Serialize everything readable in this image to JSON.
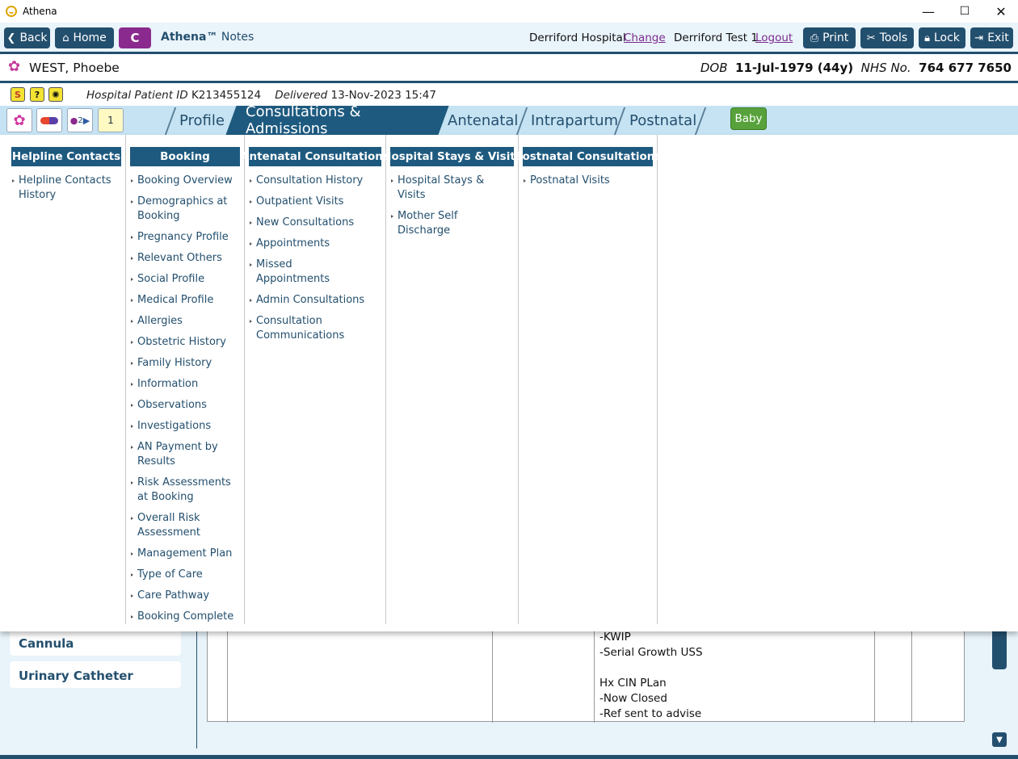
{
  "window": {
    "title": "Athena",
    "minimize": "—",
    "maximize": "☐",
    "close": "✕"
  },
  "toolbar": {
    "back": "Back",
    "home": "Home",
    "c_label": "C",
    "app_brand": "Athena™",
    "app_section": "Notes",
    "hospital": "Derriford Hospital",
    "change": "Change",
    "user": "Derriford Test 1",
    "logout": "Logout",
    "print": "Print",
    "tools": "Tools",
    "lock": "Lock",
    "exit": "Exit"
  },
  "patient": {
    "name": "WEST, Phoebe",
    "dob_label": "DOB",
    "dob": "11-Jul-1979 (44y)",
    "nhs_label": "NHS No.",
    "nhs": "764 677 7650"
  },
  "alerts": {
    "hospital_id_label": "Hospital Patient ID",
    "hospital_id": "K213455124",
    "delivered_label": "Delivered",
    "delivered": "13-Nov-2023 15:47"
  },
  "nav": {
    "tabs": [
      "Profile",
      "Consultations & Admissions",
      "Antenatal",
      "Intrapartum",
      "Postnatal"
    ],
    "active": "Consultations & Admissions",
    "baby": "Baby",
    "icon_badge_1": "2",
    "icon_badge_2": "1"
  },
  "menu": {
    "columns": [
      {
        "heading": "Helpline Contacts",
        "items": [
          "Helpline Contacts History"
        ]
      },
      {
        "heading": "Booking",
        "items": [
          "Booking Overview",
          "Demographics at Booking",
          "Pregnancy Profile",
          "Relevant Others",
          "Social Profile",
          "Medical Profile",
          "Allergies",
          "Obstetric History",
          "Family History",
          "Information",
          "Observations",
          "Investigations",
          "AN Payment by Results",
          "Risk Assessments at Booking",
          "Overall Risk Assessment",
          "Management Plan",
          "Type of Care",
          "Care Pathway",
          "Booking Complete"
        ]
      },
      {
        "heading": "Antenatal Consultations",
        "items": [
          "Consultation History",
          "Outpatient Visits",
          "New Consultations",
          "Appointments",
          "Missed Appointments",
          "Admin Consultations",
          "Consultation Communications"
        ]
      },
      {
        "heading": "Hospital Stays & Visits",
        "items": [
          "Hospital Stays & Visits",
          "Mother Self Discharge"
        ]
      },
      {
        "heading": "Postnatal Consultations",
        "items": [
          "Postnatal Visits"
        ]
      }
    ]
  },
  "background": {
    "left_items": [
      "Cannula",
      "Urinary Catheter"
    ],
    "notes_text": "-KWIP\n-Serial Growth USS\n\nHx CIN PLan\n-Now Closed\n-Ref sent to advise"
  },
  "colors": {
    "navy": "#234f6e",
    "tab_active": "#1e5a7f",
    "purple": "#8a2a8e",
    "green": "#57a23a",
    "nav_bg": "#c6e3f3"
  }
}
